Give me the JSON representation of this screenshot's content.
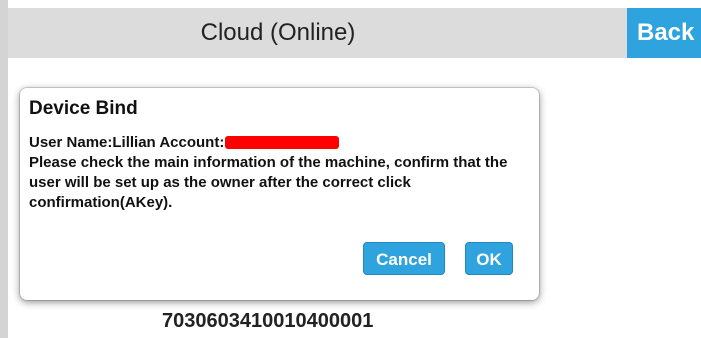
{
  "header": {
    "title": "Cloud (Online)",
    "back_label": "Back"
  },
  "dialog": {
    "title": "Device Bind",
    "user_line": "User Name:Lillian Account:",
    "message": "Please check the main information of the machine, confirm that the user will be set up as the owner after the correct click confirmation(AKey).",
    "cancel_label": "Cancel",
    "ok_label": "OK"
  },
  "device": {
    "code": "7030603410010400001"
  },
  "colors": {
    "accent": "#2ea3dd",
    "header_bg": "#dcdcdc",
    "redaction": "#ff0000"
  }
}
